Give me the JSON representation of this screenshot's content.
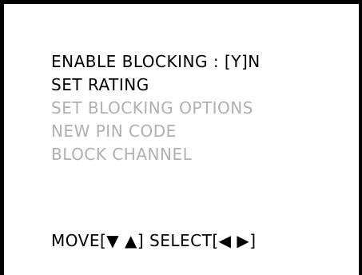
{
  "menu": {
    "items": [
      {
        "label": "ENABLE BLOCKING : [Y]N",
        "state": "enabled"
      },
      {
        "label": "SET RATING",
        "state": "enabled"
      },
      {
        "label": "SET BLOCKING OPTIONS",
        "state": "disabled"
      },
      {
        "label": "NEW PIN CODE",
        "state": "disabled"
      },
      {
        "label": "BLOCK CHANNEL",
        "state": "disabled"
      }
    ]
  },
  "footer": {
    "hint": "MOVE[▼ ▲] SELECT[◀ ▶]"
  },
  "colors": {
    "background": "#ffffff",
    "border": "#000000",
    "text_enabled": "#000000",
    "text_disabled": "#b0b0b0"
  }
}
